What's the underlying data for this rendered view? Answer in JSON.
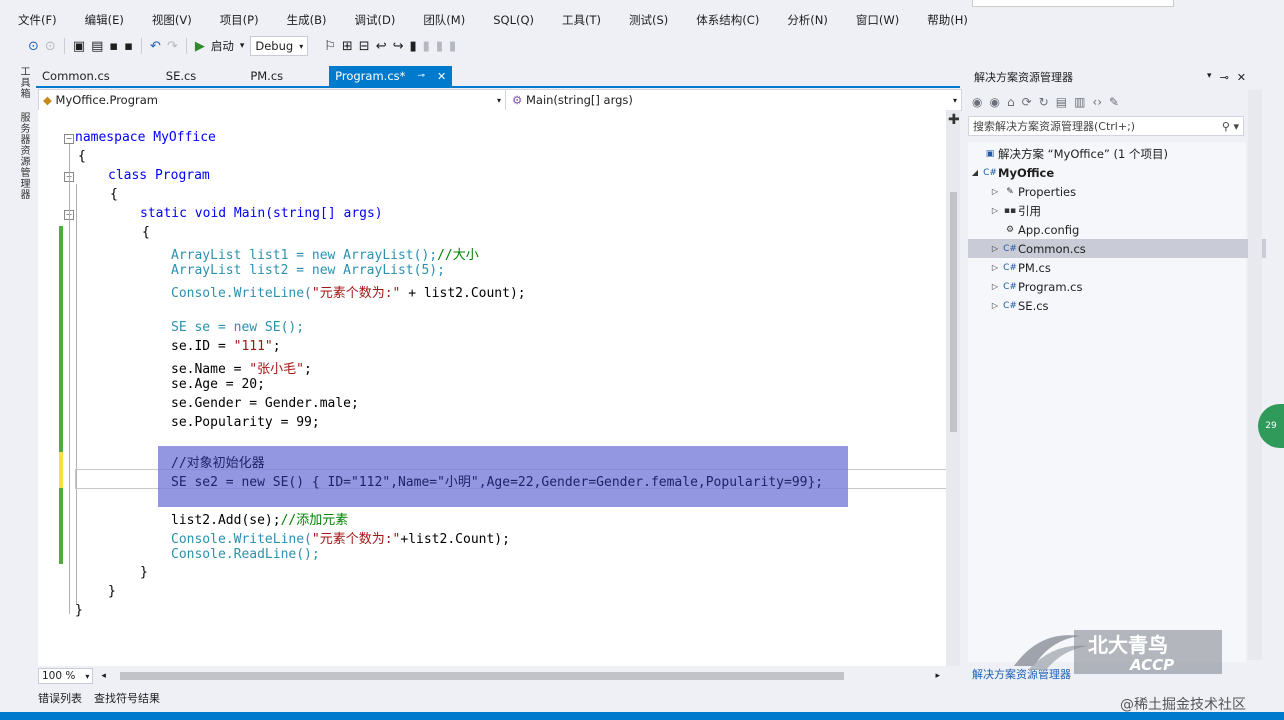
{
  "menu": [
    "文件(F)",
    "编辑(E)",
    "视图(V)",
    "项目(P)",
    "生成(B)",
    "调试(D)",
    "团队(M)",
    "SQL(Q)",
    "工具(T)",
    "测试(S)",
    "体系结构(C)",
    "分析(N)",
    "窗口(W)",
    "帮助(H)"
  ],
  "toolbar": {
    "start_label": "启动",
    "config": "Debug"
  },
  "left_strip": {
    "toolbox": "工具箱",
    "server_explorer": "服务器资源管理器"
  },
  "tabs": [
    {
      "label": "Common.cs",
      "active": false
    },
    {
      "label": "SE.cs",
      "active": false
    },
    {
      "label": "PM.cs",
      "active": false
    },
    {
      "label": "Program.cs*",
      "active": true
    }
  ],
  "navbar": {
    "class_scope": "MyOffice.Program",
    "member_scope": "Main(string[] args)"
  },
  "code": {
    "l1": "namespace MyOffice",
    "l2": "{",
    "l3": "class Program",
    "l4": "{",
    "l5": "static void Main(string[] args)",
    "l6": "{",
    "l7a": "ArrayList list1 = new ArrayList();",
    "l7c": "//大小",
    "l8": "ArrayList list2 = new ArrayList(5);",
    "l9a": "Console.WriteLine(",
    "l9s": "\"元素个数为:\"",
    "l9b": " + list2.Count);",
    "l10": "SE se = new SE();",
    "l11a": "se.ID = ",
    "l11s": "\"111\"",
    "l11b": ";",
    "l12a": "se.Name = ",
    "l12s": "\"张小毛\"",
    "l12b": ";",
    "l13": "se.Age = 20;",
    "l14": "se.Gender = Gender.male;",
    "l15": "se.Popularity = 99;",
    "l16": "//对象初始化器",
    "l17": "SE se2 = new SE() { ID=\"112\",Name=\"小明\",Age=22,Gender=Gender.female,Popularity=99};",
    "l18a": "list2.Add(se);",
    "l18c": "//添加元素",
    "l19a": "Console.WriteLine(",
    "l19s": "\"元素个数为:\"",
    "l19b": "+list2.Count);",
    "l20": "Console.ReadLine();",
    "l21": "}",
    "l22": "}",
    "l23": "}"
  },
  "zoom": "100 %",
  "bottom_tabs": [
    "错误列表",
    "查找符号结果"
  ],
  "solution_explorer": {
    "title": "解决方案资源管理器",
    "search_placeholder": "搜索解决方案资源管理器(Ctrl+;)",
    "solution": "解决方案 “MyOffice” (1 个项目)",
    "project": "MyOffice",
    "items": [
      "Properties",
      "引用",
      "App.config",
      "Common.cs",
      "PM.cs",
      "Program.cs",
      "SE.cs"
    ],
    "selected": "Common.cs",
    "bottom_tab": "解决方案资源管理器"
  },
  "watermark": {
    "logo_cn": "北大青鸟",
    "logo_en": "ACCP",
    "site": "@稀土掘金技术社区"
  },
  "badge": "29"
}
